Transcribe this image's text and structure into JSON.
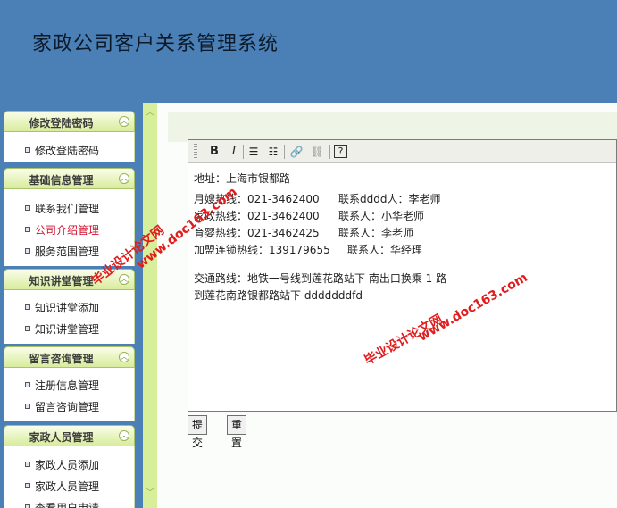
{
  "header": {
    "title": "家政公司客户关系管理系统"
  },
  "sidebar": {
    "sections": [
      {
        "title": "修改登陆密码",
        "items": [
          "修改登陆密码"
        ]
      },
      {
        "title": "基础信息管理",
        "items": [
          "联系我们管理",
          "公司介绍管理",
          "服务范围管理"
        ]
      },
      {
        "title": "知识讲堂管理",
        "items": [
          "知识讲堂添加",
          "知识讲堂管理"
        ]
      },
      {
        "title": "留言咨询管理",
        "items": [
          "注册信息管理",
          "留言咨询管理"
        ]
      },
      {
        "title": "家政人员管理",
        "items": [
          "家政人员添加",
          "家政人员管理",
          "查看用户申请"
        ]
      }
    ],
    "active_item": "公司介绍管理",
    "collapse_icon": "chevron-up-icon"
  },
  "editor": {
    "toolbar": [
      {
        "name": "bold-icon",
        "glyph": "B"
      },
      {
        "name": "italic-icon",
        "glyph": "I"
      },
      {
        "name": "ordered-list-icon",
        "glyph": "☰"
      },
      {
        "name": "unordered-list-icon",
        "glyph": "☷"
      },
      {
        "name": "insert-link-icon",
        "glyph": "🔗"
      },
      {
        "name": "remove-link-icon",
        "glyph": "⛓"
      },
      {
        "name": "help-icon",
        "glyph": "?"
      }
    ],
    "address": "地址：上海市银都路",
    "rows": [
      {
        "left": "月嫂热线：021-3462400",
        "right": "联系dddd人：李老师"
      },
      {
        "left": "家政热线：021-3462400",
        "right": "联系人：小华老师"
      },
      {
        "left": "育婴热线：021-3462425",
        "right": "联系人：李老师"
      },
      {
        "left": "加盟连锁热线：139179655",
        "right": "联系人：华经理"
      }
    ],
    "traffic_line1": "交通路线：地铁一号线到莲花路站下 南出口换乘 1 路",
    "traffic_line2": "到莲花南路银都路站下   dddddddfd"
  },
  "buttons": {
    "submit": "提交",
    "reset": "重置"
  },
  "watermark": {
    "text1": "毕业设计论文网",
    "text2": "www.doc163.com"
  },
  "colors": {
    "header_bg": "#4a80b6",
    "sidebar_head": "#d8ec9c",
    "active_link": "#d2122e",
    "watermark": "#e21c1c"
  }
}
